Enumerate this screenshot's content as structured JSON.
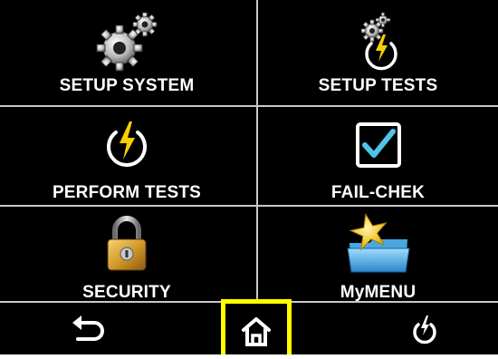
{
  "menu": {
    "tiles": [
      {
        "label": "SETUP SYSTEM",
        "icon": "gears-icon"
      },
      {
        "label": "SETUP TESTS",
        "icon": "gear-power-icon"
      },
      {
        "label": "PERFORM TESTS",
        "icon": "power-bolt-icon"
      },
      {
        "label": "FAIL-CHEK",
        "icon": "checkbox-icon"
      },
      {
        "label": "SECURITY",
        "icon": "padlock-icon"
      },
      {
        "label": "MyMENU",
        "icon": "star-folder-icon"
      }
    ]
  },
  "toolbar": {
    "buttons": [
      {
        "name": "back",
        "icon": "back-arrow-icon"
      },
      {
        "name": "home",
        "icon": "home-icon",
        "highlighted": true
      },
      {
        "name": "power",
        "icon": "power-icon"
      }
    ]
  },
  "colors": {
    "background": "#000000",
    "text": "#ffffff",
    "bolt": "#f5d000",
    "check": "#4fc3e8",
    "highlight": "#ffff00"
  }
}
